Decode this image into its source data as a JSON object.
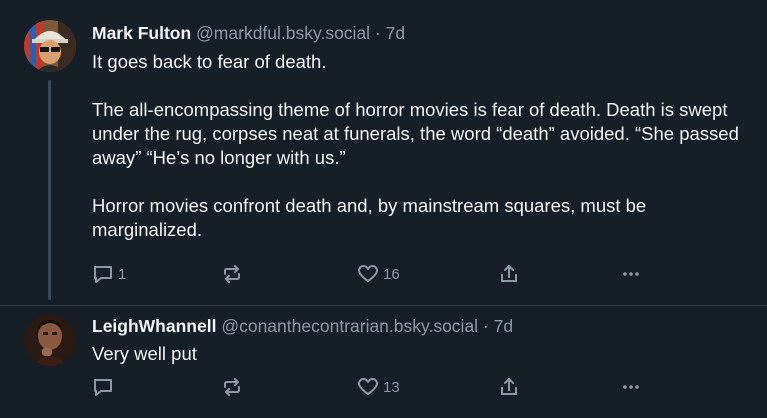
{
  "posts": [
    {
      "author_name": "Mark Fulton",
      "handle": "@markdful.bsky.social",
      "separator": "·",
      "age": "7d",
      "paragraphs": [
        "It goes back to fear of death.",
        "The all-encompassing theme of horror movies is fear of death. Death is swept under the rug, corpses neat at funerals, the word “death” avoided. “She passed away” “He’s no longer with us.”",
        "Horror movies confront death and, by mainstream squares, must be marginalized."
      ],
      "reply_count": "1",
      "repost_count": "",
      "like_count": "16"
    },
    {
      "author_name": "LeighWhannell",
      "handle": "@conanthecontrarian.bsky.social",
      "separator": "·",
      "age": "7d",
      "paragraphs": [
        "Very well put"
      ],
      "reply_count": "",
      "repost_count": "",
      "like_count": "13"
    }
  ],
  "icons": {
    "reply": "reply-icon",
    "repost": "repost-icon",
    "like": "heart-icon",
    "share": "share-icon",
    "more": "more-icon"
  },
  "colors": {
    "background": "#161e27",
    "text": "#f1f3f5",
    "muted": "#8b98a5",
    "thread_line": "#3b4a5a",
    "divider": "#2e3c4b"
  }
}
